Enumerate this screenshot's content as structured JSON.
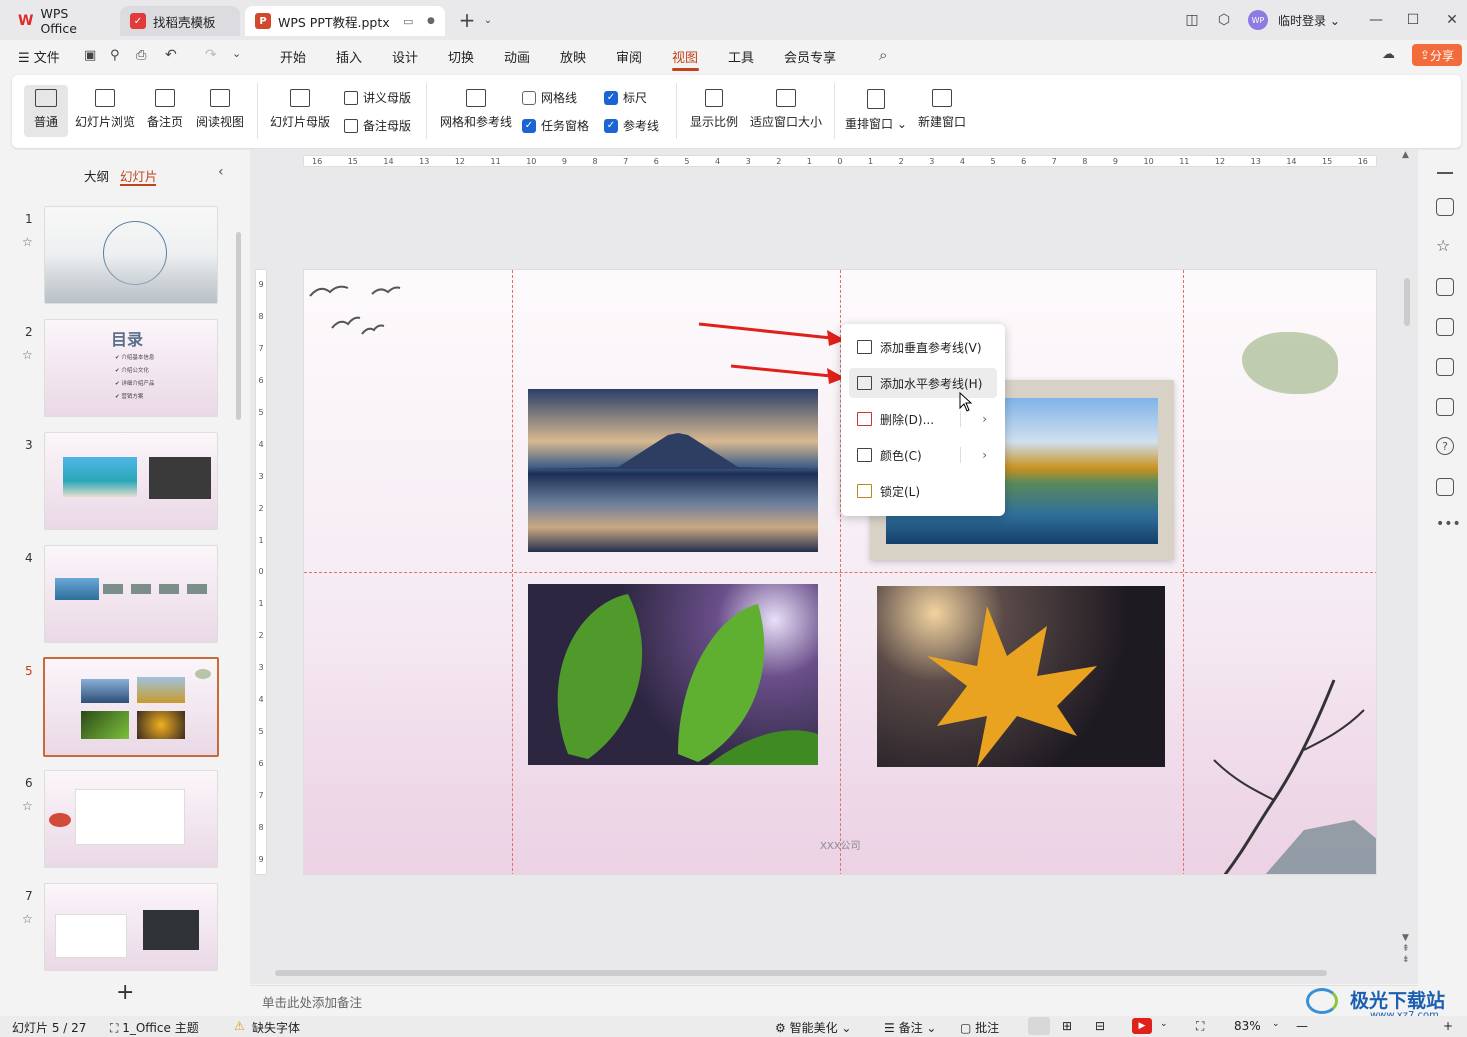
{
  "titlebar": {
    "tabs": [
      {
        "label": "WPS Office",
        "icon": "wps-logo-icon"
      },
      {
        "label": "找稻壳模板",
        "icon": "docer-icon"
      },
      {
        "label": "WPS PPT教程.pptx",
        "icon": "ppt-icon"
      }
    ],
    "user": "临时登录",
    "avatar_text": "WP"
  },
  "menubar": {
    "file": "文件",
    "items": [
      "开始",
      "插入",
      "设计",
      "切换",
      "动画",
      "放映",
      "审阅",
      "视图",
      "工具",
      "会员专享"
    ],
    "active": "视图",
    "share": "分享"
  },
  "ribbon": {
    "normal": "普通",
    "slide_sorter": "幻灯片浏览",
    "notes_page": "备注页",
    "reading_view": "阅读视图",
    "slide_master": "幻灯片母版",
    "handout_master": "讲义母版",
    "notes_master": "备注母版",
    "grid_guides": "网格和参考线",
    "gridlines": {
      "label": "网格线",
      "checked": false
    },
    "task_pane": {
      "label": "任务窗格",
      "checked": true
    },
    "ruler": {
      "label": "标尺",
      "checked": true
    },
    "guides": {
      "label": "参考线",
      "checked": true
    },
    "zoom": "显示比例",
    "fit_window": "适应窗口大小",
    "arrange": "重排窗口",
    "new_window": "新建窗口"
  },
  "left_panel": {
    "tab_outline": "大纲",
    "tab_slides": "幻灯片",
    "slide_numbers": [
      "1",
      "2",
      "3",
      "4",
      "5",
      "6",
      "7"
    ],
    "active_slide": "5",
    "thumb2_title": "目录",
    "thumb2_items": [
      "介绍基本信息",
      "介绍公文化",
      "详细介绍产品",
      "营销方案"
    ]
  },
  "ruler_h": [
    "16",
    "15",
    "14",
    "13",
    "12",
    "11",
    "10",
    "9",
    "8",
    "7",
    "6",
    "5",
    "4",
    "3",
    "2",
    "1",
    "0",
    "1",
    "2",
    "3",
    "4",
    "5",
    "6",
    "7",
    "8",
    "9",
    "10",
    "11",
    "12",
    "13",
    "14",
    "15",
    "16"
  ],
  "ruler_v": [
    "9",
    "8",
    "7",
    "6",
    "5",
    "4",
    "3",
    "2",
    "1",
    "0",
    "1",
    "2",
    "3",
    "4",
    "5",
    "6",
    "7",
    "8",
    "9"
  ],
  "slide": {
    "footer": "XXX公司"
  },
  "context_menu": {
    "items": [
      {
        "label": "添加垂直参考线(V)",
        "icon": "vertical-guide-icon"
      },
      {
        "label": "添加水平参考线(H)",
        "icon": "horizontal-guide-icon"
      },
      {
        "label": "删除(D)...",
        "icon": "delete-guide-icon"
      },
      {
        "label": "颜色(C)",
        "icon": "guide-color-icon"
      },
      {
        "label": "锁定(L)",
        "icon": "lock-guide-icon"
      }
    ]
  },
  "notes": {
    "placeholder": "单击此处添加备注"
  },
  "status": {
    "slide_count": "幻灯片 5 / 27",
    "theme": "1_Office 主题",
    "missing_font": "缺失字体",
    "beautify": "智能美化",
    "notes": "备注",
    "comments": "批注",
    "zoom": "83%"
  },
  "watermark": {
    "title": "极光下载站",
    "url": "www.xz7.com"
  },
  "colors": {
    "accent": "#c0431b",
    "share": "#f26b3a",
    "checkbox": "#1a64d4",
    "arrow": "#e0201a"
  }
}
